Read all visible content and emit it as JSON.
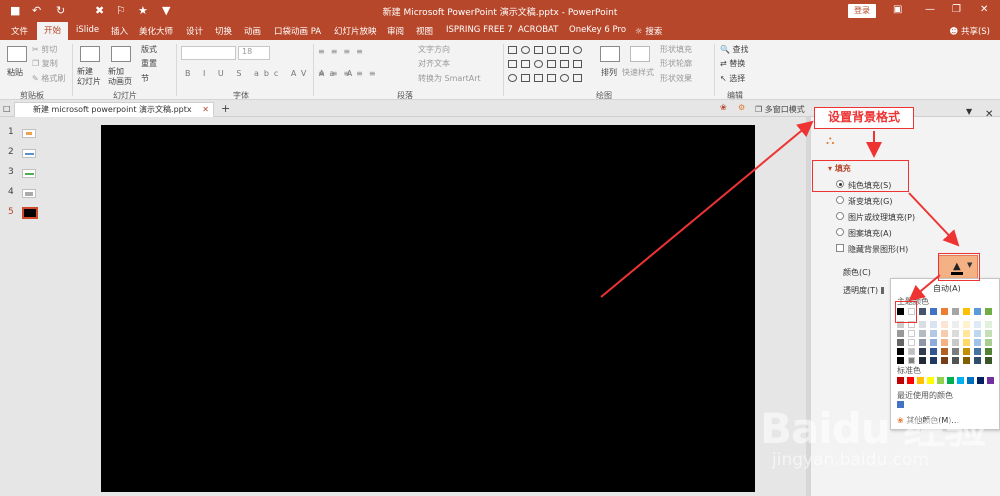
{
  "window": {
    "title": "新建 Microsoft PowerPoint 演示文稿.pptx - PowerPoint",
    "login_label": "登录",
    "share_label": "共享(S)"
  },
  "tabs": [
    "文件",
    "开始",
    "iSlide",
    "插入",
    "美化大师",
    "设计",
    "切换",
    "动画",
    "口袋动画 PA",
    "幻灯片放映",
    "审阅",
    "视图",
    "ISPRING FREE 7",
    "ACROBAT",
    "OneKey 6 Pro",
    "搜索"
  ],
  "ribbon": {
    "clipboard": {
      "paste": "粘贴",
      "cut": "剪切",
      "copy": "复制",
      "format_painter": "格式刷",
      "group": "剪贴板"
    },
    "slides": {
      "new_slide": "新建\n幻灯片",
      "new_animation": "新加\n动画页",
      "layout": "版式",
      "reset": "重置",
      "section": "节",
      "group": "幻灯片"
    },
    "font": {
      "size": "18",
      "group": "字体",
      "buttons": "B I U S abc AV Aa A"
    },
    "paragraph": {
      "text_direction": "文字方向",
      "align_text": "对齐文本",
      "smartart": "转换为 SmartArt",
      "group": "段落"
    },
    "drawing": {
      "arrange": "排列",
      "quick_styles": "快速样式",
      "shape_fill": "形状填充",
      "shape_outline": "形状轮廓",
      "shape_effects": "形状效果",
      "group": "绘图"
    },
    "editing": {
      "find": "查找",
      "replace": "替换",
      "select": "选择",
      "group": "编辑"
    }
  },
  "document": {
    "tab_label": "新建 microsoft powerpoint 演示文稿.pptx",
    "multiwindow": "多窗口模式"
  },
  "thumbnails": [
    {
      "num": "1",
      "color": "#f0a050"
    },
    {
      "num": "2",
      "color": "#5a8fd0"
    },
    {
      "num": "3",
      "color": "#4caf50"
    },
    {
      "num": "4",
      "color": "#aaaaaa"
    },
    {
      "num": "5",
      "color": "#000000"
    }
  ],
  "format_pane": {
    "callout_title": "设置背景格式",
    "section_fill": "填充",
    "options": [
      "纯色填充(S)",
      "渐变填充(G)",
      "图片或纹理填充(P)",
      "图案填充(A)"
    ],
    "hide_bg": "隐藏背景图形(H)",
    "color_label": "颜色(C)",
    "transparency_label": "透明度(T)"
  },
  "color_popup": {
    "auto": "自动(A)",
    "theme_colors": "主题颜色",
    "standard_colors": "标准色",
    "recent_colors": "最近使用的颜色",
    "more_colors": "其他颜色(M)...",
    "theme_top": [
      "#000000",
      "#ffffff",
      "#44546a",
      "#4472c4",
      "#ed7d31",
      "#a5a5a5",
      "#ffc000",
      "#5b9bd5",
      "#70ad47"
    ],
    "standard": [
      "#c00000",
      "#ff0000",
      "#ffc000",
      "#ffff00",
      "#92d050",
      "#00b050",
      "#00b0f0",
      "#0070c0",
      "#002060",
      "#7030a0"
    ],
    "recent": [
      "#4472c4"
    ]
  },
  "watermark": {
    "main": "Baidu 经验",
    "sub": "jingyan.baidu.com"
  }
}
